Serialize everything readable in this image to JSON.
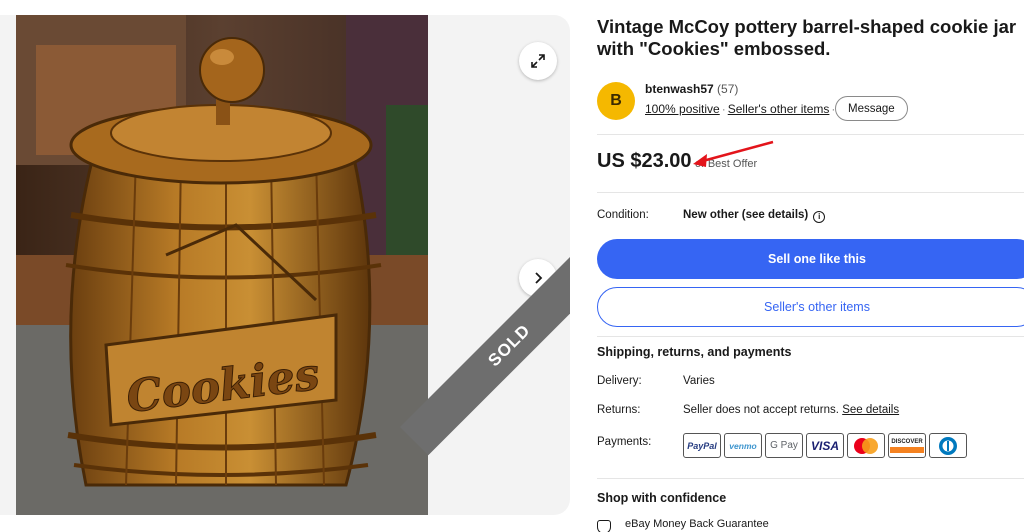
{
  "listing": {
    "title": "Vintage McCoy pottery barrel-shaped cookie jar with \"Cookies\" embossed.",
    "price": "US $23.00",
    "best_offer": "or Best Offer",
    "sold_label": "SOLD"
  },
  "seller": {
    "avatar_letter": "B",
    "name": "btenwash57",
    "score": "(57)",
    "positive": "100% positive",
    "other_items_link": "Seller's other items",
    "message_button": "Message"
  },
  "condition": {
    "label": "Condition:",
    "value": "New other (see details)"
  },
  "buttons": {
    "sell_one": "Sell one like this",
    "seller_other_items": "Seller's other items"
  },
  "shipping": {
    "section_title": "Shipping, returns, and payments",
    "delivery_label": "Delivery:",
    "delivery_value": "Varies",
    "returns_label": "Returns:",
    "returns_value": "Seller does not accept returns.",
    "returns_link": "See details",
    "payments_label": "Payments:",
    "payment_methods": [
      "PayPal",
      "venmo",
      "G Pay",
      "VISA",
      "Mastercard",
      "DISCOVER",
      "Diners Club"
    ]
  },
  "confidence": {
    "section_title": "Shop with confidence",
    "guarantee": "eBay Money Back Guarantee"
  },
  "photo": {
    "embossed_text": "Cookies"
  },
  "colors": {
    "accent": "#3665f3",
    "avatar": "#f5b800",
    "annotation_arrow": "#e3141b"
  }
}
